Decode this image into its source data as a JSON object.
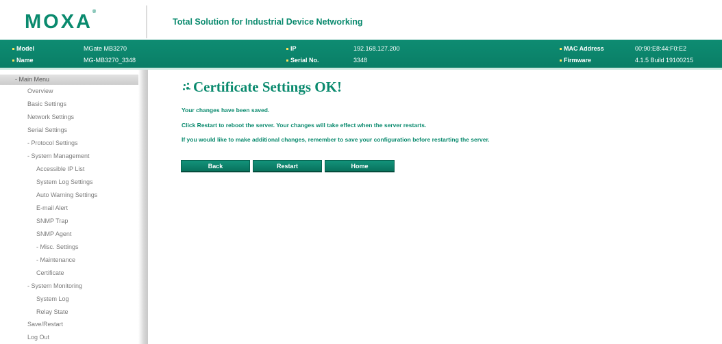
{
  "header": {
    "logo": "MOXA",
    "logo_mark": "®",
    "tagline": "Total Solution for Industrial Device Networking"
  },
  "device_info": {
    "model_label": "Model",
    "model_value": "MGate MB3270",
    "name_label": "Name",
    "name_value": "MG-MB3270_3348",
    "ip_label": "IP",
    "ip_value": "192.168.127.200",
    "serial_label": "Serial No.",
    "serial_value": "3348",
    "mac_label": "MAC Address",
    "mac_value": "00:90:E8:44:F0:E2",
    "firmware_label": "Firmware",
    "firmware_value": "4.1.5 Build 19100215"
  },
  "sidebar": {
    "main_menu": "- Main Menu",
    "items": [
      "Overview",
      "Basic Settings",
      "Network Settings",
      "Serial Settings",
      "- Protocol Settings",
      "- System Management",
      "Accessible IP List",
      "System Log Settings",
      "Auto Warning Settings",
      "E-mail Alert",
      "SNMP Trap",
      "SNMP Agent",
      "- Misc. Settings",
      "- Maintenance",
      "Certificate",
      "- System Monitoring",
      "System Log",
      "Relay State",
      "Save/Restart",
      "Log Out"
    ]
  },
  "main": {
    "title": "Certificate Settings OK!",
    "messages": [
      "Your changes have been saved.",
      "Click Restart to reboot the server. Your changes will take effect when the server restarts.",
      "If you would like to make additional changes, remember to save your configuration before restarting the server."
    ],
    "buttons": {
      "back": "Back",
      "restart": "Restart",
      "home": "Home"
    }
  },
  "colors": {
    "brand_green": "#0a8a6e",
    "bullet_yellow": "#ffe45c"
  }
}
